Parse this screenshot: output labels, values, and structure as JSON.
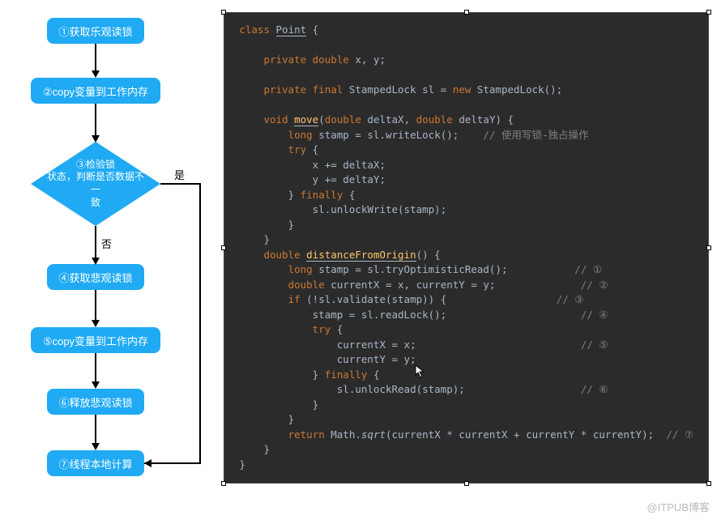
{
  "flowchart": {
    "nodes": {
      "n1": "①获取乐观读锁",
      "n2": "②copy变量到工作内存",
      "n3": "③检验锁\n状态，判断是否数据不一\n致",
      "n4": "④获取悲观读锁",
      "n5": "⑤copy变量到工作内存",
      "n6": "⑥释放悲观读锁",
      "n7": "⑦线程本地计算"
    },
    "labels": {
      "yes": "是",
      "no": "否"
    }
  },
  "code": {
    "l1_kw": "class",
    "l1_name": "Point",
    "l2_kw": "private double",
    "l2_txt": " x, y;",
    "l3a": "private final ",
    "l3b": "StampedLock sl = ",
    "l3c": "new ",
    "l3d": "StampedLock();",
    "l4a": "void ",
    "l4b": "move",
    "l4c": "(",
    "l4d": "double ",
    "l4e": "deltaX, ",
    "l4f": "double ",
    "l4g": "deltaY) {",
    "l5a": "long ",
    "l5b": "stamp = sl.writeLock();",
    "l5c": "    // 使用写锁-独占操作",
    "l6a": "try ",
    "l6b": "{",
    "l7": "x += deltaX;",
    "l8": "y += deltaY;",
    "l9a": "} ",
    "l9b": "finally ",
    "l9c": "{",
    "l10": "sl.unlockWrite(stamp);",
    "l11": "}",
    "l12": "}",
    "d1a": "double ",
    "d1b": "distanceFromOrigin",
    "d1c": "() {",
    "d2a": "long ",
    "d2b": "stamp = sl.tryOptimisticRead();",
    "d2c": "// ①",
    "d3a": "double ",
    "d3b": "currentX = x, currentY = y;",
    "d3c": "// ②",
    "d4a": "if ",
    "d4b": "(!sl.validate(stamp)) {",
    "d4c": "// ③",
    "d5": "stamp = sl.readLock();",
    "d5c": "// ④",
    "d6a": "try ",
    "d6b": "{",
    "d7": "currentX = x;",
    "d7c": "// ⑤",
    "d8": "currentY = y;",
    "d9a": "} ",
    "d9b": "finally ",
    "d9c": "{",
    "d10": "sl.unlockRead(stamp);",
    "d10c": "// ⑥",
    "d11": "}",
    "d12": "}",
    "d13a": "return ",
    "d13b": "Math.",
    "d13c": "sqrt",
    "d13d": "(currentX * currentX + currentY * currentY);",
    "d13e": "// ⑦",
    "d14": "}",
    "d15": "}"
  },
  "watermark": "@ITPUB博客"
}
